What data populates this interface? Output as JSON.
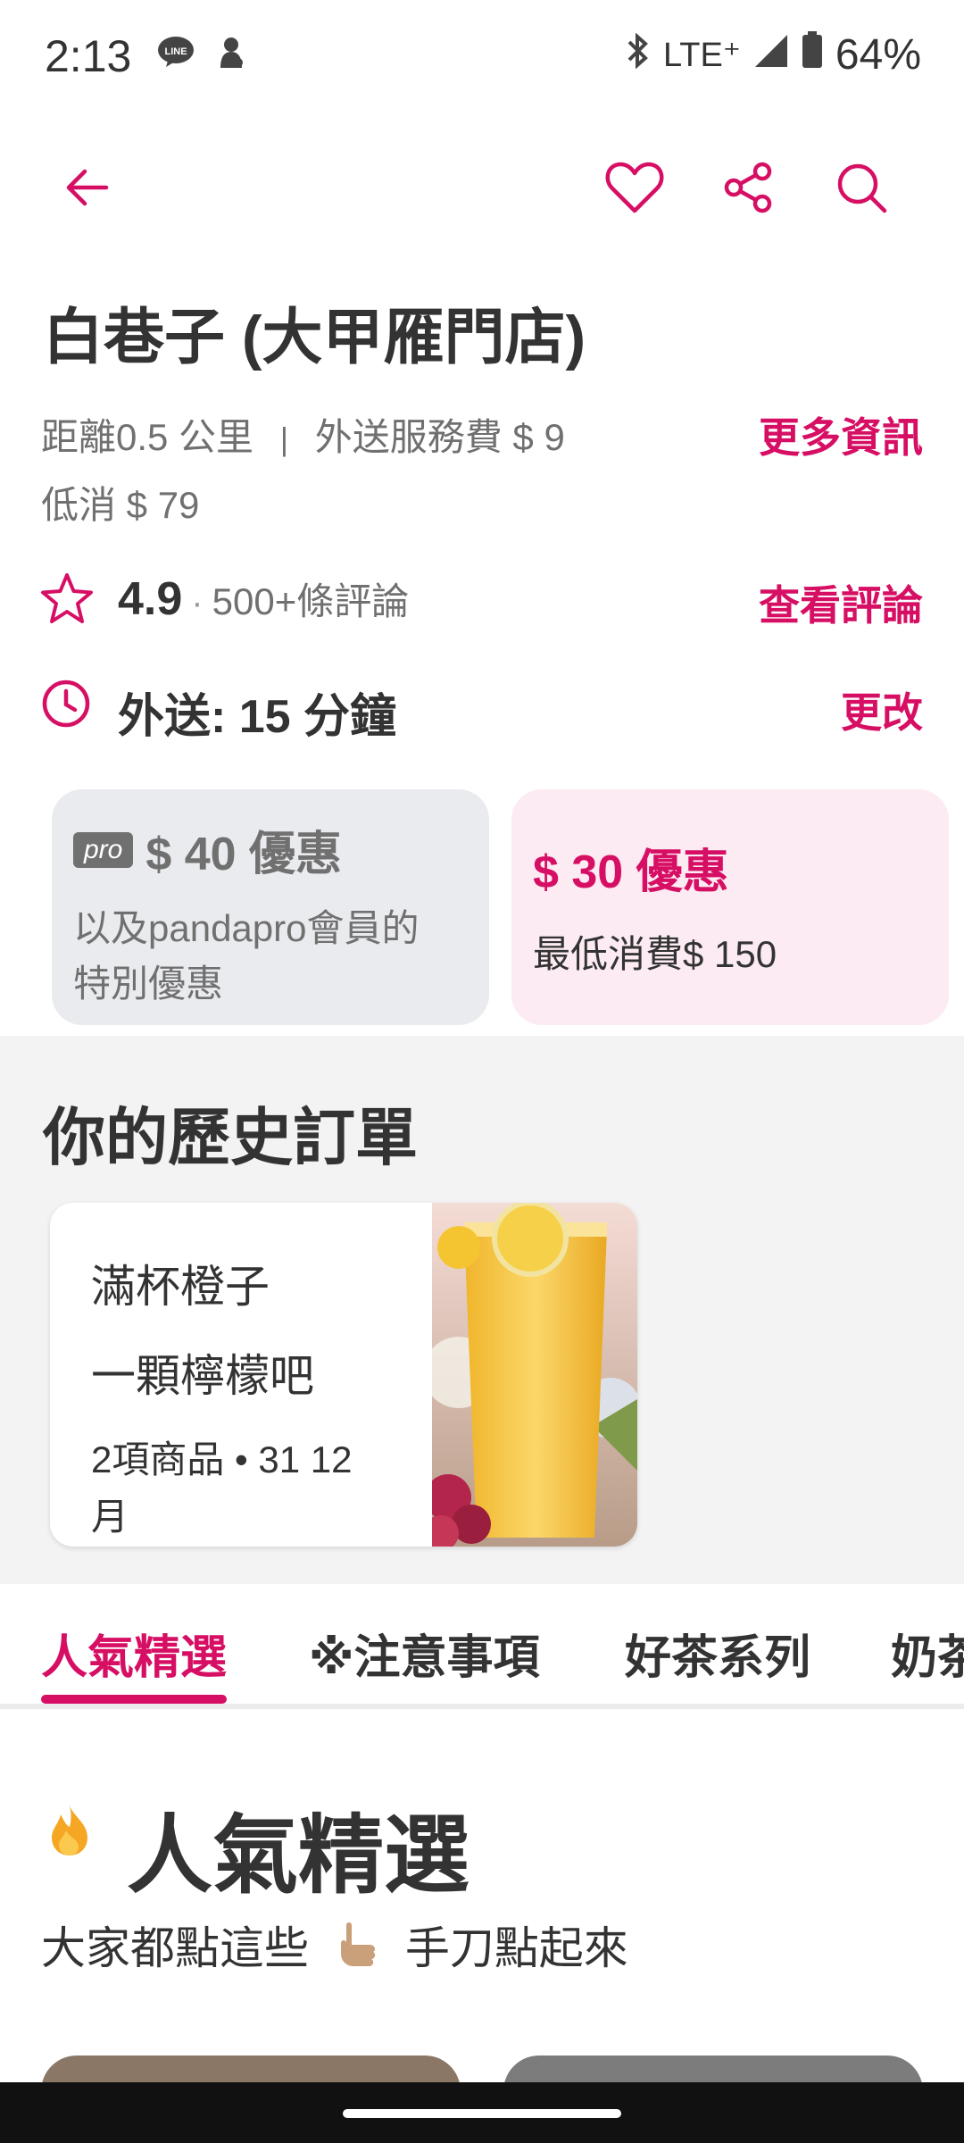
{
  "status_bar": {
    "time": "2:13",
    "network": "LTE⁺",
    "battery": "64%",
    "icons": [
      "line-app-icon",
      "mascot-icon",
      "bluetooth-icon",
      "signal-icon",
      "battery-icon"
    ]
  },
  "nav": {
    "icons": [
      "back-arrow-icon",
      "heart-icon",
      "share-icon",
      "search-icon"
    ],
    "accent": "#d70f64"
  },
  "restaurant": {
    "name": "白巷子 (大甲雁門店)",
    "distance": "距離0.5 公里",
    "separator": "|",
    "delivery_fee": "外送服務費 $ 9",
    "min_order": "低消 $ 79",
    "more_info": "更多資訊",
    "rating": "4.9",
    "rating_dot": "·",
    "reviews": "500+條評論",
    "view_reviews": "查看評論",
    "delivery_time": "外送: 15 分鐘",
    "change": "更改"
  },
  "promos": [
    {
      "badge": "pro",
      "title": "$ 40 優惠",
      "desc": "以及pandapro會員的特別優惠"
    },
    {
      "title": "$ 30 優惠",
      "desc": "最低消費$ 150"
    }
  ],
  "history": {
    "title": "你的歷史訂單",
    "order": {
      "item1": "滿杯橙子",
      "item2": "一顆檸檬吧",
      "summary": "2項商品 • 31 12 月"
    }
  },
  "tabs": [
    "人氣精選",
    "※注意事項",
    "好茶系列",
    "奶茶"
  ],
  "section": {
    "title": "人氣精選",
    "subtitle_a": "大家都點這些",
    "subtitle_b": "手刀點起來",
    "icons": [
      "fire-icon",
      "pointing-hand-icon"
    ]
  }
}
